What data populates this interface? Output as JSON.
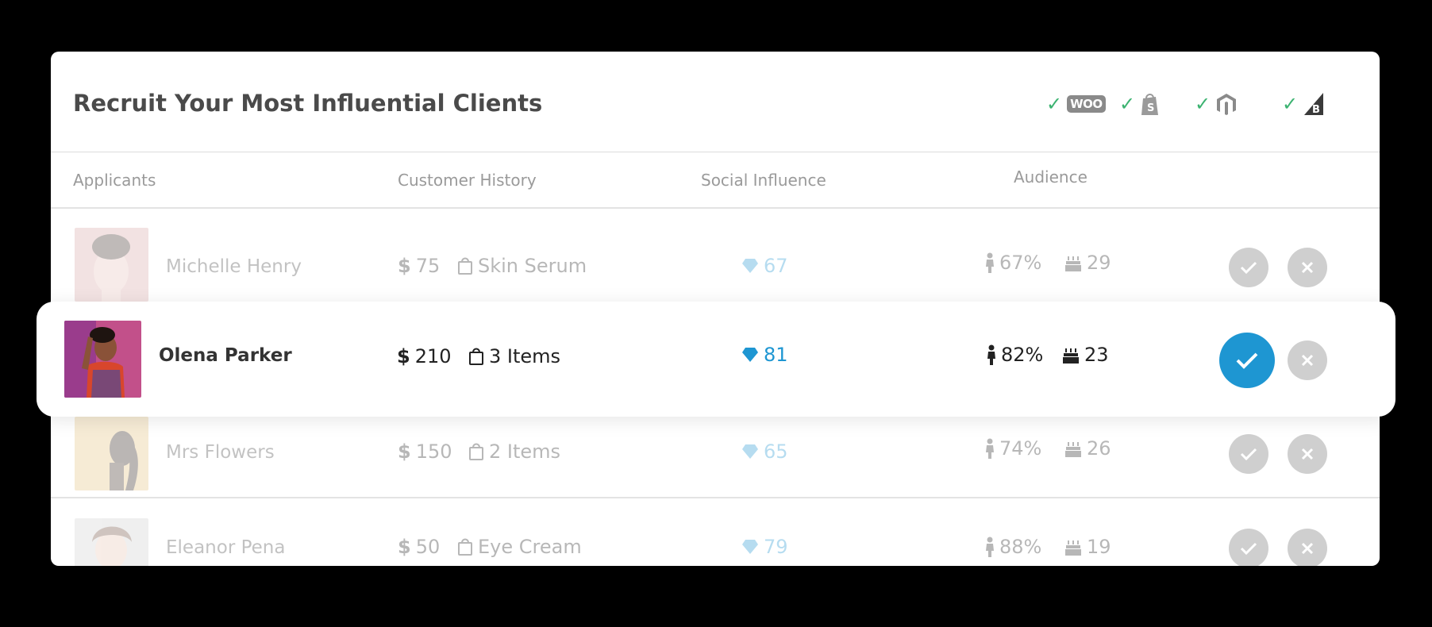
{
  "title": "Recruit Your Most Influential Clients",
  "platforms": [
    {
      "name": "woocommerce",
      "label": "WOO"
    },
    {
      "name": "shopify",
      "label": ""
    },
    {
      "name": "magento",
      "label": ""
    },
    {
      "name": "bigcommerce",
      "label": ""
    }
  ],
  "columns": {
    "applicants": "Applicants",
    "customer_history": "Customer History",
    "social_influence": "Social Influence",
    "audience": "Audience"
  },
  "rows": [
    {
      "name": "Michelle Henry",
      "spend": "75",
      "purchase": "Skin Serum",
      "score": "67",
      "female_pct": "67%",
      "age": "29",
      "selected": false
    },
    {
      "name": "Olena Parker",
      "spend": "210",
      "purchase": "3 Items",
      "score": "81",
      "female_pct": "82%",
      "age": "23",
      "selected": true
    },
    {
      "name": "Mrs Flowers",
      "spend": "150",
      "purchase": "2 Items",
      "score": "65",
      "female_pct": "74%",
      "age": "26",
      "selected": false
    },
    {
      "name": "Eleanor Pena",
      "spend": "50",
      "purchase": "Eye Cream",
      "score": "79",
      "female_pct": "88%",
      "age": "19",
      "selected": false
    }
  ],
  "colors": {
    "accent": "#1e96d2",
    "check_green": "#3cb371",
    "button_grey": "#cfcfcf"
  },
  "symbols": {
    "currency": "$"
  }
}
